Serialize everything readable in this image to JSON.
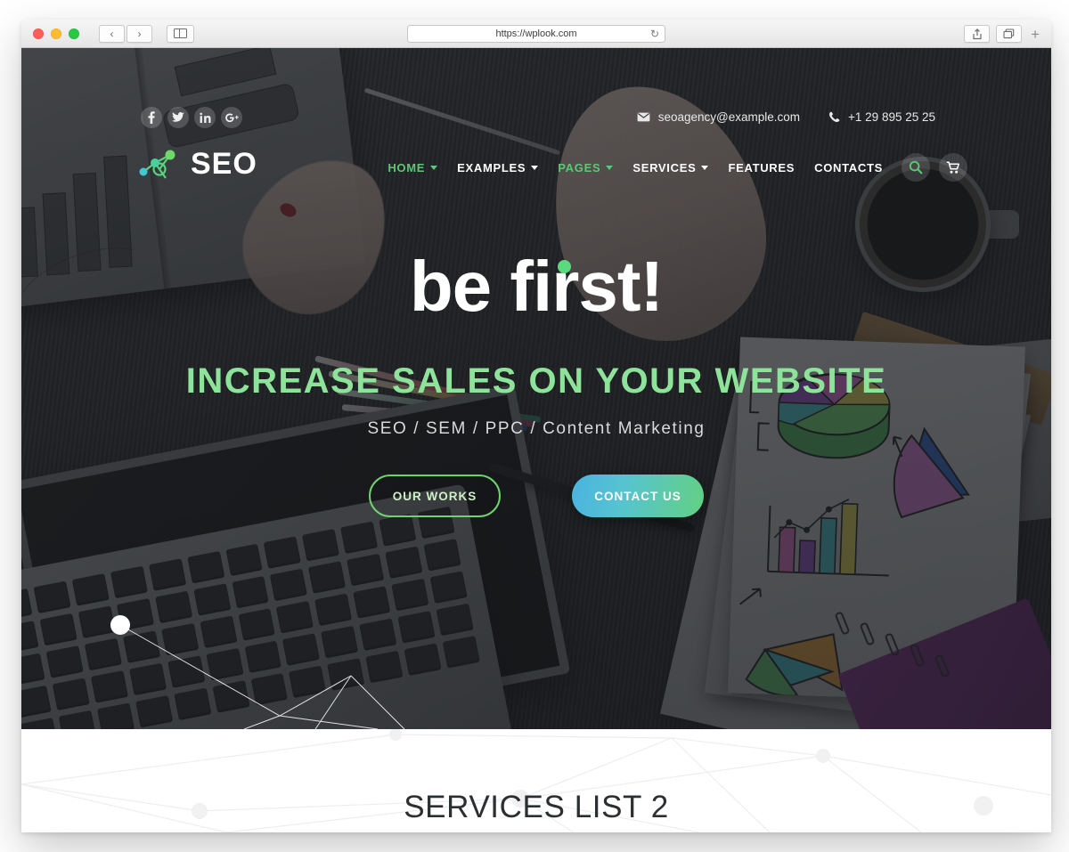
{
  "browser": {
    "url": "https://wplook.com",
    "reload_icon": "reload-icon",
    "back_icon": "‹",
    "forward_icon": "›",
    "sidebar_icon": "sidebar-icon",
    "share_icon": "share-icon",
    "tabs_icon": "tabs-icon",
    "new_tab_label": "+"
  },
  "header": {
    "social": [
      {
        "name": "facebook",
        "glyph": "f"
      },
      {
        "name": "twitter",
        "glyph": "t"
      },
      {
        "name": "linkedin",
        "glyph": "in"
      },
      {
        "name": "googleplus",
        "glyph": "g+"
      }
    ],
    "brand": "SEO",
    "contact": {
      "email": "seoagency@example.com",
      "phone": "+1 29 895 25 25"
    },
    "nav": [
      {
        "label": "HOME",
        "active": true,
        "caret": true
      },
      {
        "label": "EXAMPLES",
        "active": false,
        "caret": true
      },
      {
        "label": "PAGES",
        "active": true,
        "caret": true
      },
      {
        "label": "SERVICES",
        "active": false,
        "caret": true
      },
      {
        "label": "FEATURES",
        "active": false,
        "caret": false
      },
      {
        "label": "CONTACTS",
        "active": false,
        "caret": false
      }
    ],
    "search_icon": "search-icon",
    "cart_icon": "cart-icon"
  },
  "hero": {
    "headline": "be first!",
    "subheadline": "INCREASE SALES ON YOUR WEBSITE",
    "tagline": "SEO / SEM / PPC / Content Marketing",
    "primary_button": "OUR WORKS",
    "secondary_button": "CONTACT US"
  },
  "section": {
    "title": "SERVICES LIST 2"
  },
  "colors": {
    "accent_green": "#5bc873",
    "subheadline_green": "#8ee39a",
    "button_gradient_start": "#4bb3e0",
    "button_gradient_end": "#63d083",
    "hero_overlay": "#1a1c1f",
    "text_light": "#e8e8e8"
  }
}
